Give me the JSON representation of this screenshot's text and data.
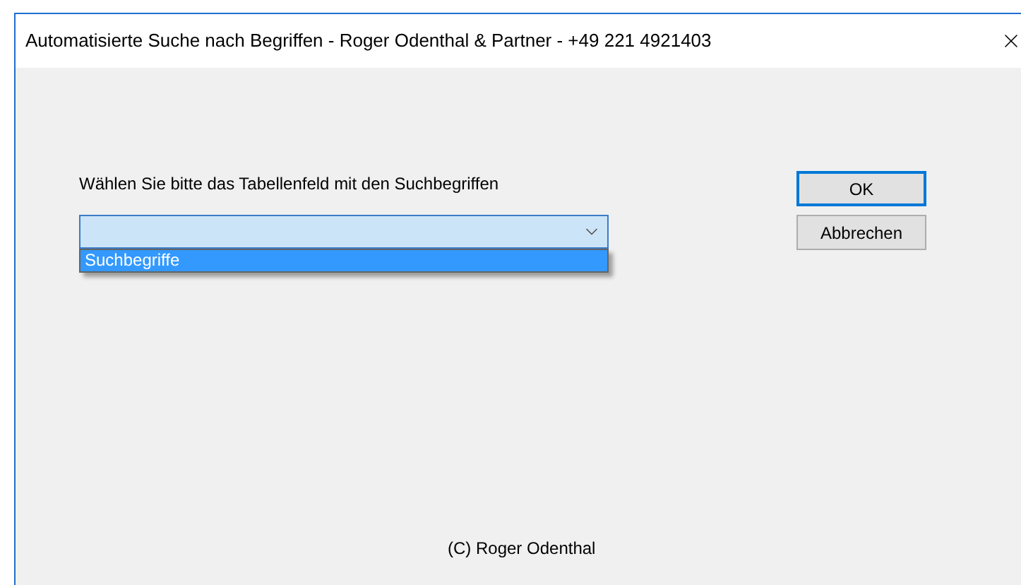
{
  "window": {
    "title": "Automatisierte Suche nach Begriffen - Roger Odenthal & Partner - +49 221 4921403"
  },
  "prompt": "Wählen Sie bitte das Tabellenfeld  mit den Suchbegriffen",
  "combo": {
    "expanded": true,
    "items": [
      {
        "label": "Suchbegriffe",
        "selected": true
      }
    ]
  },
  "buttons": [
    {
      "label": "OK",
      "default": true
    },
    {
      "label": "Abbrechen",
      "default": false
    }
  ],
  "footer": "(C) Roger Odenthal"
}
